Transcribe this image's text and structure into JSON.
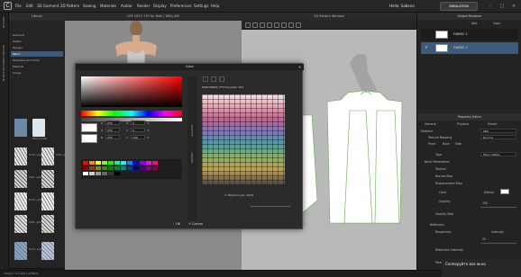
{
  "menu": {
    "items": [
      "File",
      "Edit",
      "3D Garment",
      "2D Pattern",
      "Sewing",
      "Materials",
      "Avatar",
      "Render",
      "Display",
      "Preferences",
      "Settings",
      "Help"
    ],
    "user": "Hello, Sabena",
    "simulation": "SIMULATION"
  },
  "left_strip": {
    "labels": [
      "HISTORY",
      "MODULAR CONFIGURATOR"
    ]
  },
  "library": {
    "title": "Library",
    "items": [
      "Garment",
      "Avatar",
      "Hanger",
      "Fabric",
      "Hardware and Trims",
      "Material",
      "Image"
    ],
    "selected_index": 3,
    "folder_label": "Normal_Map",
    "thumbs": [
      "Dorfs...plan",
      "Cottl...plan",
      "Dorfs...plan",
      "Cottl...plan",
      "Dorfs...plan",
      "Cottl...plan",
      "Dorfs...plan",
      "Cottl...plan",
      "Dorfs...plan",
      "Cottl...plan"
    ]
  },
  "view3d": {
    "title": "LRE 2023 719 for Bulk | WELLAM"
  },
  "view2d": {
    "title": "2D Pattern Window"
  },
  "color_dialog": {
    "title": "Color",
    "values": [
      {
        "label": "R",
        "value": "255"
      },
      {
        "label": "G",
        "value": "255"
      },
      {
        "label": "B",
        "value": "255"
      }
    ],
    "hsv": [
      {
        "label": "H",
        "value": "0"
      },
      {
        "label": "S",
        "value": "0"
      },
      {
        "label": "V",
        "value": "100"
      }
    ],
    "pct": "%",
    "pantone_title": "PANTONE(R) FHI Polyester TSX",
    "copyright": "© Pantone LLC, 2020",
    "tab_labels": [
      "PALETTE",
      "LIBRARY"
    ],
    "ok": "OK",
    "cancel": "Cancel"
  },
  "right_panel": {
    "object_browser": "Object Browser",
    "fabrics": [
      "FABRIC 1",
      "FABRIC 2"
    ],
    "add": "Add",
    "copy": "Copy",
    "property_editor": "Property Editor",
    "tabs": [
      "General",
      "Physical",
      "Preset"
    ],
    "material": "Material",
    "material_value": "PBR",
    "texture_mapping": "Texture Mapping",
    "texture_mapping_value": "Normal",
    "front_back_side": [
      "Front",
      "Back",
      "Side"
    ],
    "type_label": "Type",
    "type_value": "Fabric Matte",
    "basic_params": "Basic Parameters",
    "params": [
      "Texture",
      "Normal Map",
      "Displacement Map",
      "Color",
      "Opacity",
      "Opacity Map",
      "Reflection",
      "Roughness",
      "Reflection Intensity",
      "Metalness"
    ],
    "color_value": "(None)",
    "roughness_map": "Intensity",
    "value_100": "100",
    "value_50": "50"
  },
  "toast": {
    "text": "Скопируйте все окна"
  },
  "status": {
    "text": "Version: 8.2.293 (r23867)"
  }
}
